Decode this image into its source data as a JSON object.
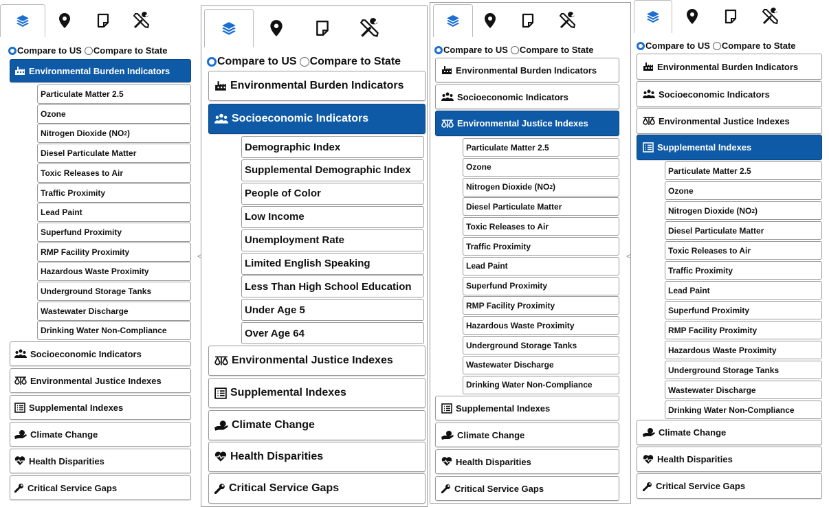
{
  "tabs": [
    "layers-icon",
    "map-marker-icon",
    "note-icon",
    "tools-icon"
  ],
  "compare": {
    "us": "Compare to US",
    "state": "Compare to State"
  },
  "categories": {
    "env_burden": "Environmental Burden Indicators",
    "socioeconomic": "Socioeconomic Indicators",
    "ej_indexes": "Environmental Justice Indexes",
    "supplemental": "Supplemental Indexes",
    "climate": "Climate Change",
    "health": "Health Disparities",
    "critical": "Critical Service Gaps"
  },
  "indicators": [
    "Particulate Matter 2.5",
    "Ozone",
    "Nitrogen Dioxide (NO",
    "Diesel Particulate Matter",
    "Toxic Releases to Air",
    "Traffic Proximity",
    "Lead Paint",
    "Superfund Proximity",
    "RMP Facility Proximity",
    "Hazardous Waste Proximity",
    "Underground Storage Tanks",
    "Wastewater Discharge",
    "Drinking Water Non-Compliance"
  ],
  "no2": {
    "sub": "2",
    "close": ")"
  },
  "socio_items": [
    "Demographic Index",
    "Supplemental Demographic Index",
    "People of Color",
    "Low Income",
    "Unemployment Rate",
    "Limited English Speaking",
    "Less Than High School Education",
    "Under Age 5",
    "Over Age 64"
  ],
  "collapse_chevron": "<",
  "colors": {
    "accent": "#0f5aa6",
    "tab_icon_active": "#1a6fd1"
  }
}
